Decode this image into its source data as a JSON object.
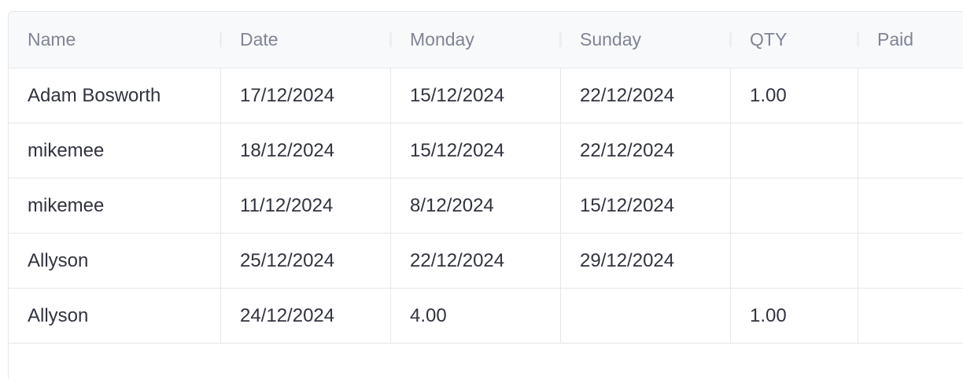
{
  "table": {
    "columns": [
      "Name",
      "Date",
      "Monday",
      "Sunday",
      "QTY",
      "Paid"
    ],
    "rows": [
      [
        "Adam Bosworth",
        "17/12/2024",
        "15/12/2024",
        "22/12/2024",
        "1.00",
        ""
      ],
      [
        "mikemee",
        "18/12/2024",
        "15/12/2024",
        "22/12/2024",
        "",
        ""
      ],
      [
        "mikemee",
        "11/12/2024",
        "8/12/2024",
        "15/12/2024",
        "",
        ""
      ],
      [
        "Allyson",
        "25/12/2024",
        "22/12/2024",
        "29/12/2024",
        "",
        ""
      ],
      [
        "Allyson",
        "24/12/2024",
        "4.00",
        "",
        "1.00",
        ""
      ]
    ]
  }
}
